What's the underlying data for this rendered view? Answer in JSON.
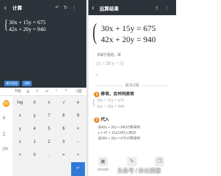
{
  "left": {
    "header_title": "计算",
    "equations": [
      "30x + 15y = 675",
      "42x + 20y = 940"
    ],
    "pills": [
      "解方程组",
      "求解"
    ],
    "fn_keys": [
      "log",
      "∠",
      "√",
      "↵",
      "↑",
      "÷",
      "⌫"
    ],
    "side_keys": [
      "f(x)",
      "θ",
      "∑",
      "∫dx"
    ],
    "keys": [
      [
        "log",
        "π",
        "x",
        "√",
        "e"
      ],
      [
        "x",
        "y",
        "7",
        "8",
        "9"
      ],
      [
        "y",
        "4",
        "5",
        "6",
        "×"
      ],
      [
        "z",
        "1",
        "2",
        "3",
        "−"
      ],
      [
        "<",
        "0",
        ".",
        "=",
        "+"
      ],
      [
        "",
        "",
        "",
        "",
        ""
      ]
    ]
  },
  "right": {
    "header_title": "运算结果",
    "equations": [
      "30x + 15y = 675",
      "42x + 20y = 940"
    ],
    "prompt": "求解方程组，得",
    "solution": "(x = 20   y = 5)",
    "process_label": "解决过程",
    "step1_title": "移项，合并同类项",
    "step1_eq": [
      "30x + 15y = 675",
      "42x + 20y = 940"
    ],
    "step2_title": "代入",
    "step2_lines": [
      "由42x + 20y = 940计算得到",
      "y = 47 + 21x/10代入到30",
      "由30x + 15y = 675计算得到"
    ],
    "bottom_buttons": [
      "保存结果",
      "",
      ""
    ]
  },
  "watermark": "头条号 / 办公资源"
}
